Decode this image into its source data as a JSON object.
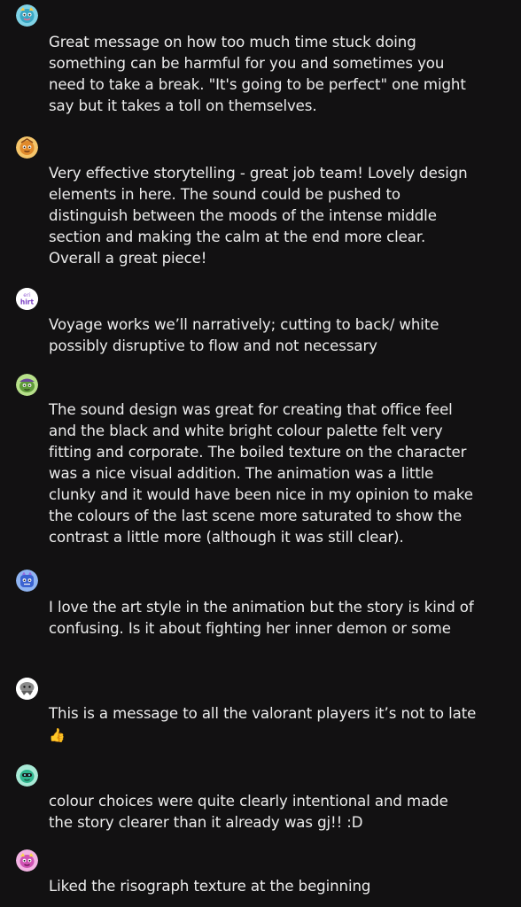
{
  "comments": [
    {
      "avatar_icon": "teal-creature-avatar-icon",
      "text": "Great message on how too much time stuck doing\nsomething can be harmful for you and sometimes you\nneed to take a break. \"It's going to be perfect\" one might\nsay but it takes a toll on themselves."
    },
    {
      "avatar_icon": "orange-creature-avatar-icon",
      "text": "Very effective storytelling - great job team! Lovely design\nelements in here. The sound could be pushed to\ndistinguish between the moods of the intense middle\nsection and making the calm at the end more clear.\nOverall a great piece!"
    },
    {
      "avatar_icon": "text-logo-avatar-icon",
      "avatar_text_top": "eri",
      "avatar_text_bottom": "hirt",
      "text": "Voyage works we’ll narratively; cutting to back/ white\npossibly disruptive to flow and not necessary"
    },
    {
      "avatar_icon": "green-creature-avatar-icon",
      "text": "The sound design was great for creating that office feel\nand the black and white bright colour palette felt very\nfitting and corporate. The boiled texture on the character\nwas a nice visual addition. The animation was a little\nclunky and it would have been nice in my opinion to make\nthe colours of the last scene more saturated to show the\ncontrast a little more (although it was still clear)."
    },
    {
      "avatar_icon": "blue-creature-avatar-icon",
      "text": "I love the art style in the animation but the story is kind of\nconfusing. Is it about fighting her inner demon or some"
    },
    {
      "avatar_icon": "grey-creature-avatar-icon",
      "text": "This is a message to all the valorant players it’s not to late",
      "emoji": "👍"
    },
    {
      "avatar_icon": "mint-creature-avatar-icon",
      "text": "colour choices were quite clearly intentional and made\nthe story clearer than it already was gj!! :D"
    },
    {
      "avatar_icon": "pink-creature-avatar-icon",
      "text": "Liked the risograph texture at the beginning"
    }
  ]
}
